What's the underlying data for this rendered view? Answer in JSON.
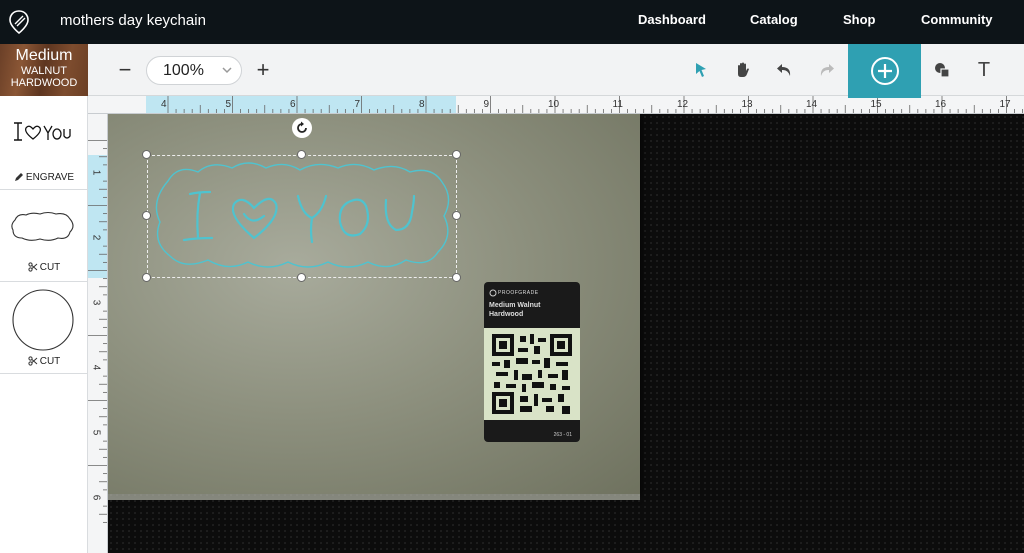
{
  "app": {
    "document_title": "mothers day keychain",
    "nav": [
      {
        "label": "Dashboard"
      },
      {
        "label": "Catalog"
      },
      {
        "label": "Shop"
      },
      {
        "label": "Community"
      }
    ]
  },
  "material": {
    "grade": "Medium",
    "species": "WALNUT",
    "type": "HARDWOOD"
  },
  "toolbar": {
    "zoom_out": "−",
    "zoom_level": "100%",
    "zoom_in": "+",
    "text_tool": "T"
  },
  "ruler": {
    "top": [
      "4",
      "5",
      "6",
      "7",
      "8",
      "9",
      "10",
      "11",
      "12",
      "13",
      "14",
      "15",
      "16",
      "17"
    ],
    "left": [
      "1",
      "2",
      "3",
      "4",
      "5",
      "6"
    ]
  },
  "sidebar": {
    "items": [
      {
        "artwork": "I ♡ YOU",
        "operation": "ENGRAVE"
      },
      {
        "artwork": "",
        "operation": "CUT"
      },
      {
        "artwork": "",
        "operation": "CUT"
      }
    ]
  },
  "canvas": {
    "label": {
      "brand": "PROOFGRADE",
      "grade": "Medium Walnut",
      "material": "Hardwood",
      "code": "263 - 01"
    }
  },
  "colors": {
    "accent": "#2fa0b2",
    "engrave_stroke": "#4fc3cf",
    "ruler_highlight": "#bfe6f2"
  }
}
